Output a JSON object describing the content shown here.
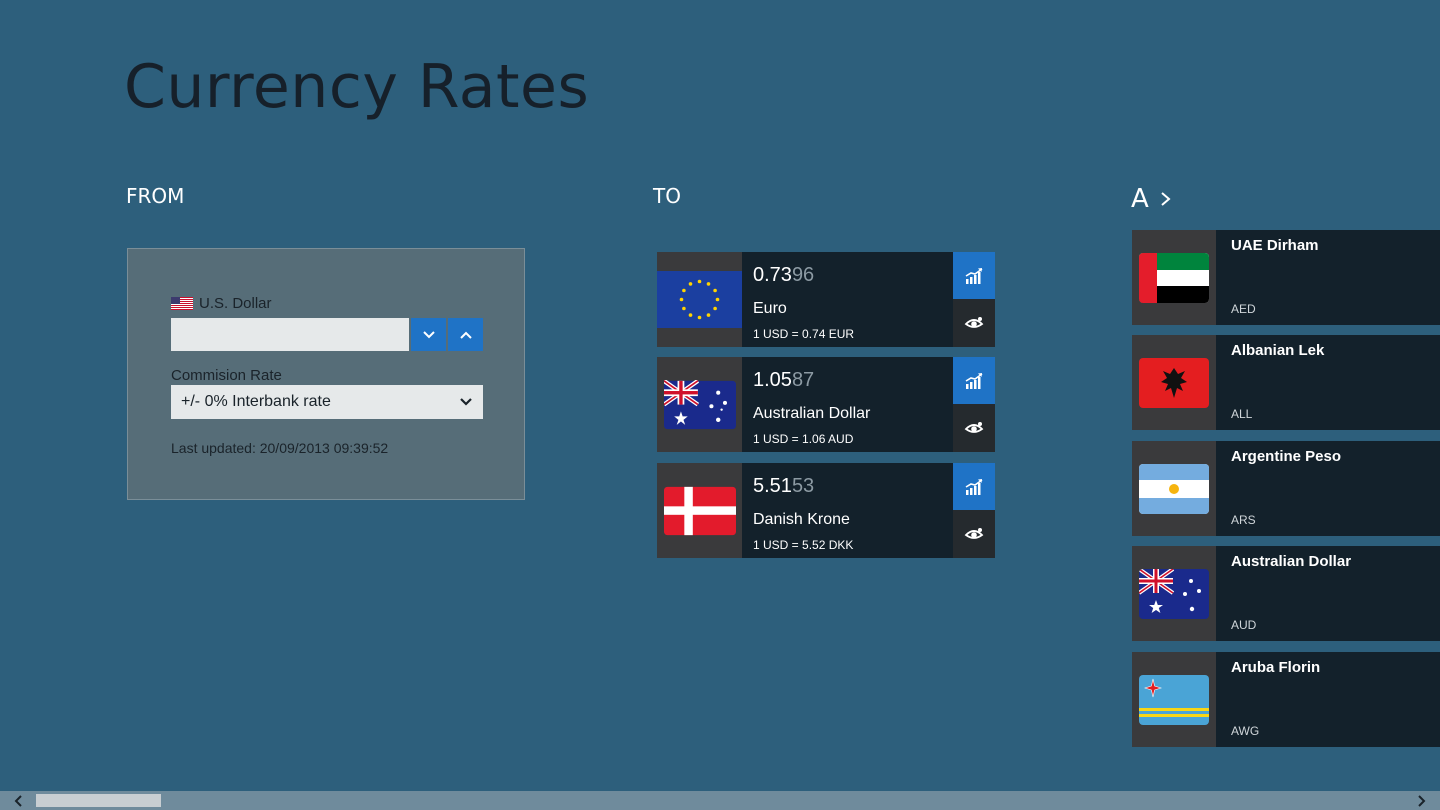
{
  "app": {
    "title": "Currency Rates"
  },
  "from": {
    "heading": "FROM",
    "currency_label": "U.S. Dollar",
    "amount_value": "",
    "commission_label": "Commision Rate",
    "commission_selected": "+/- 0% Interbank rate",
    "last_updated": "Last updated: 20/09/2013 09:39:52"
  },
  "to": {
    "heading": "TO",
    "cards": [
      {
        "rate_main": "0.73",
        "rate_dim": "96",
        "name": "Euro",
        "conversion": "1 USD = 0.74 EUR",
        "flag": "eu-flag"
      },
      {
        "rate_main": "1.05",
        "rate_dim": "87",
        "name": "Australian Dollar",
        "conversion": "1 USD = 1.06 AUD",
        "flag": "australia-flag"
      },
      {
        "rate_main": "5.51",
        "rate_dim": "53",
        "name": "Danish Krone",
        "conversion": "1 USD = 5.52 DKK",
        "flag": "denmark-flag"
      }
    ]
  },
  "list": {
    "group_letter": "A",
    "items": [
      {
        "name": "UAE Dirham",
        "code": "AED",
        "flag": "uae-flag"
      },
      {
        "name": "Albanian Lek",
        "code": "ALL",
        "flag": "albania-flag"
      },
      {
        "name": "Argentine Peso",
        "code": "ARS",
        "flag": "argentina-flag"
      },
      {
        "name": "Australian Dollar",
        "code": "AUD",
        "flag": "australia-flag"
      },
      {
        "name": "Aruba Florin",
        "code": "AWG",
        "flag": "aruba-flag"
      }
    ]
  },
  "colors": {
    "background": "#2d5f7c",
    "accent": "#1f73c6",
    "card": "#13212b"
  }
}
